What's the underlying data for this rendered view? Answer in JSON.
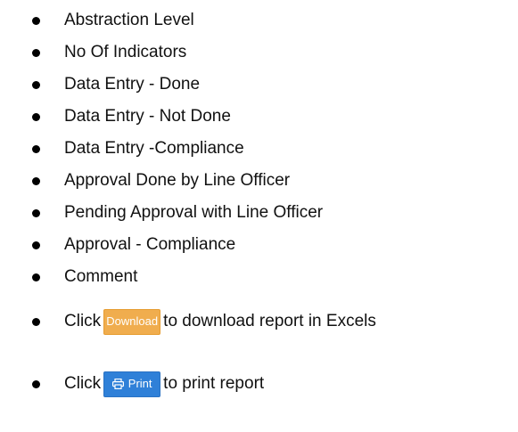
{
  "items": [
    {
      "text": "Abstraction Level"
    },
    {
      "text": "No Of Indicators"
    },
    {
      "text": "Data Entry - Done"
    },
    {
      "text": "Data Entry - Not Done"
    },
    {
      "text": "Data Entry -Compliance"
    },
    {
      "text": "Approval Done by Line Officer"
    },
    {
      "text": "Pending Approval with Line Officer"
    },
    {
      "text": "Approval - Compliance"
    },
    {
      "text": "Comment"
    }
  ],
  "download_item": {
    "prefix": "Click",
    "button_label": "Download",
    "suffix": "to download report in Excels"
  },
  "print_item": {
    "prefix": "Click",
    "button_label": "Print",
    "button_icon": "printer-icon",
    "suffix": "to print report"
  },
  "colors": {
    "download_button": "#f0ad4e",
    "print_button": "#2f80d8",
    "bullet": "#000000"
  }
}
